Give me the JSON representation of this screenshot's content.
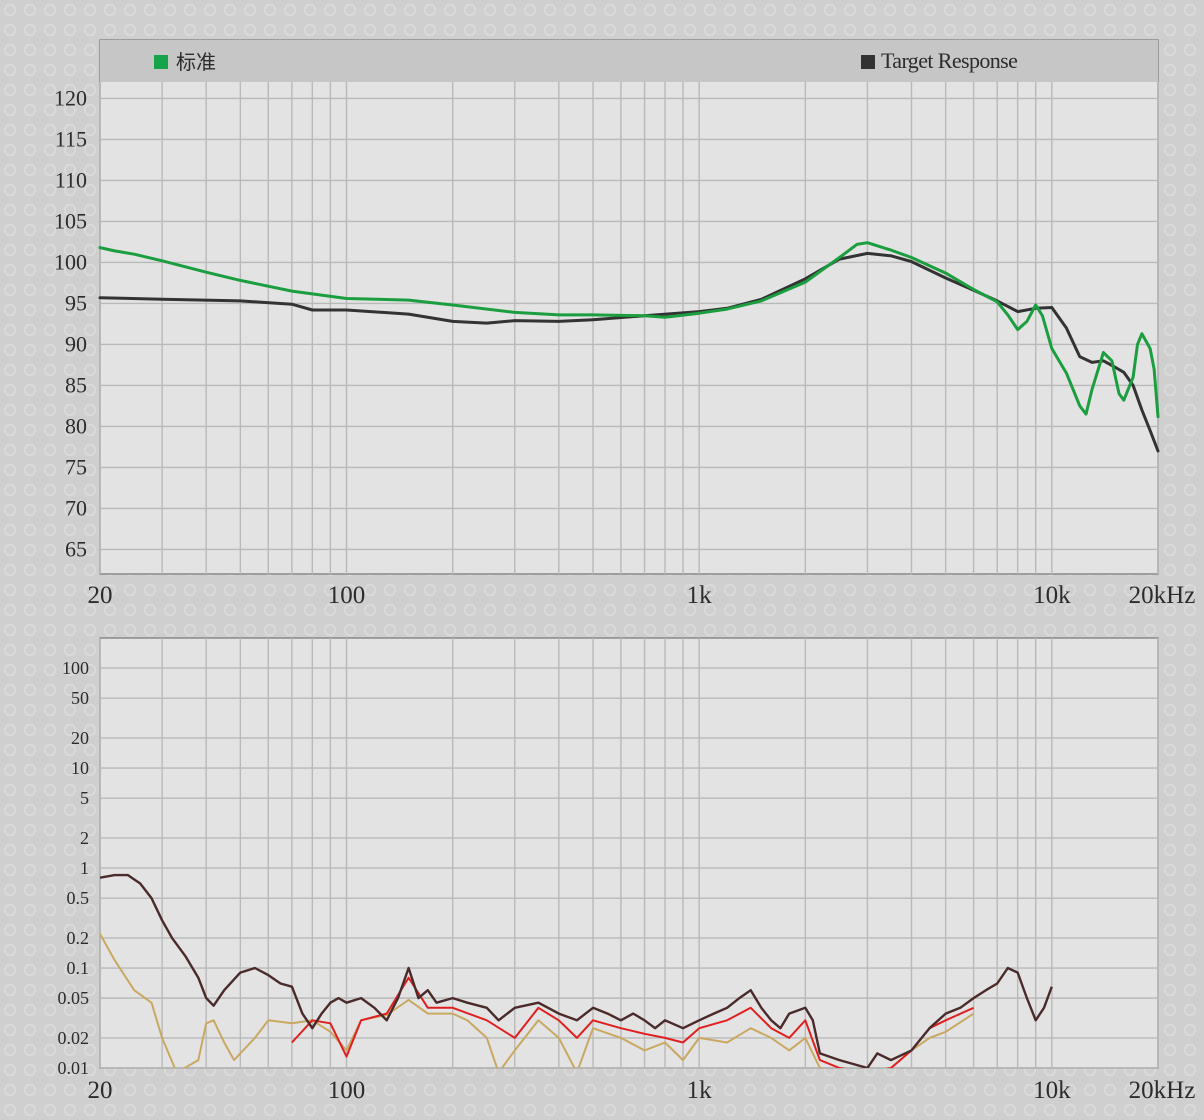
{
  "chart_data": [
    {
      "type": "line",
      "title": "",
      "xlabel": "",
      "ylabel": "",
      "x_scale": "log",
      "xlim": [
        20,
        20000
      ],
      "ylim": [
        62,
        122
      ],
      "x_tick_labels": [
        {
          "x": 20,
          "label": "20"
        },
        {
          "x": 100,
          "label": "100"
        },
        {
          "x": 1000,
          "label": "1k"
        },
        {
          "x": 10000,
          "label": "10k"
        },
        {
          "x": 20000,
          "label": "20kHz"
        }
      ],
      "y_tick_labels": [
        "120",
        "115",
        "110",
        "105",
        "100",
        "95",
        "90",
        "85",
        "80",
        "75",
        "70",
        "65"
      ],
      "y_ticks": [
        120,
        115,
        110,
        105,
        100,
        95,
        90,
        85,
        80,
        75,
        70,
        65
      ],
      "grid": true,
      "legend_position": "top",
      "legend": [
        {
          "label": "标准",
          "color": "#16a34a"
        },
        {
          "label": "Target Response",
          "color": "#333333"
        }
      ],
      "series": [
        {
          "name": "标准",
          "color": "#1a9e3f",
          "points": [
            [
              20,
              101.8
            ],
            [
              22,
              101.4
            ],
            [
              25,
              101
            ],
            [
              30,
              100.2
            ],
            [
              40,
              98.8
            ],
            [
              50,
              97.8
            ],
            [
              70,
              96.5
            ],
            [
              100,
              95.6
            ],
            [
              150,
              95.4
            ],
            [
              200,
              94.8
            ],
            [
              300,
              93.9
            ],
            [
              400,
              93.6
            ],
            [
              500,
              93.6
            ],
            [
              700,
              93.5
            ],
            [
              800,
              93.3
            ],
            [
              1000,
              93.8
            ],
            [
              1200,
              94.3
            ],
            [
              1500,
              95.3
            ],
            [
              2000,
              97.6
            ],
            [
              2500,
              100.6
            ],
            [
              2800,
              102.2
            ],
            [
              3000,
              102.4
            ],
            [
              3500,
              101.5
            ],
            [
              4000,
              100.6
            ],
            [
              5000,
              98.7
            ],
            [
              6000,
              96.7
            ],
            [
              7000,
              95.2
            ],
            [
              7500,
              93.6
            ],
            [
              8000,
              91.8
            ],
            [
              8500,
              92.8
            ],
            [
              9000,
              94.8
            ],
            [
              9400,
              93.5
            ],
            [
              10000,
              89.5
            ],
            [
              11000,
              86.5
            ],
            [
              12000,
              82.5
            ],
            [
              12500,
              81.5
            ],
            [
              13000,
              84.5
            ],
            [
              14000,
              89
            ],
            [
              14800,
              88
            ],
            [
              15500,
              84
            ],
            [
              16000,
              83.2
            ],
            [
              17000,
              86
            ],
            [
              17500,
              90
            ],
            [
              18000,
              91.3
            ],
            [
              19000,
              89.5
            ],
            [
              19500,
              87
            ],
            [
              20000,
              81.2
            ]
          ]
        },
        {
          "name": "Target Response",
          "color": "#333333",
          "points": [
            [
              20,
              95.7
            ],
            [
              30,
              95.5
            ],
            [
              50,
              95.3
            ],
            [
              70,
              94.9
            ],
            [
              80,
              94.2
            ],
            [
              100,
              94.2
            ],
            [
              150,
              93.7
            ],
            [
              200,
              92.8
            ],
            [
              250,
              92.6
            ],
            [
              300,
              92.9
            ],
            [
              400,
              92.8
            ],
            [
              500,
              93
            ],
            [
              700,
              93.5
            ],
            [
              1000,
              94
            ],
            [
              1200,
              94.4
            ],
            [
              1500,
              95.5
            ],
            [
              2000,
              98
            ],
            [
              2500,
              100.4
            ],
            [
              3000,
              101.1
            ],
            [
              3500,
              100.8
            ],
            [
              4000,
              100.1
            ],
            [
              5000,
              98.1
            ],
            [
              6000,
              96.6
            ],
            [
              7000,
              95.3
            ],
            [
              8000,
              94
            ],
            [
              9000,
              94.4
            ],
            [
              10000,
              94.5
            ],
            [
              11000,
              92
            ],
            [
              12000,
              88.5
            ],
            [
              13000,
              87.8
            ],
            [
              14000,
              88
            ],
            [
              15000,
              87.3
            ],
            [
              16000,
              86.6
            ],
            [
              17000,
              85
            ],
            [
              18000,
              82
            ],
            [
              19000,
              79.5
            ],
            [
              20000,
              77
            ]
          ]
        }
      ]
    },
    {
      "type": "line",
      "title": "",
      "xlabel": "",
      "ylabel": "",
      "x_scale": "log",
      "y_scale": "log",
      "xlim": [
        20,
        20000
      ],
      "ylim": [
        0.01,
        200
      ],
      "x_tick_labels": [
        {
          "x": 20,
          "label": "20"
        },
        {
          "x": 100,
          "label": "100"
        },
        {
          "x": 1000,
          "label": "1k"
        },
        {
          "x": 10000,
          "label": "10k"
        },
        {
          "x": 20000,
          "label": "20kHz"
        }
      ],
      "y_tick_labels": [
        "100",
        "50",
        "20",
        "10",
        "5",
        "2",
        "1",
        "0.5",
        "0.2",
        "0.1",
        "0.05",
        "0.02",
        "0.01"
      ],
      "y_ticks": [
        100,
        50,
        20,
        10,
        5,
        2,
        1,
        0.5,
        0.2,
        0.1,
        0.05,
        0.02,
        0.01
      ],
      "grid": true,
      "series": [
        {
          "color": "#c9a862",
          "points": [
            [
              20,
              0.22
            ],
            [
              22,
              0.12
            ],
            [
              25,
              0.06
            ],
            [
              28,
              0.045
            ],
            [
              30,
              0.02
            ],
            [
              33,
              0.009
            ],
            [
              38,
              0.012
            ],
            [
              40,
              0.028
            ],
            [
              42,
              0.03
            ],
            [
              45,
              0.018
            ],
            [
              48,
              0.012
            ],
            [
              55,
              0.02
            ],
            [
              60,
              0.03
            ],
            [
              70,
              0.028
            ],
            [
              80,
              0.03
            ],
            [
              90,
              0.023
            ],
            [
              100,
              0.015
            ],
            [
              110,
              0.03
            ],
            [
              130,
              0.034
            ],
            [
              150,
              0.048
            ],
            [
              170,
              0.035
            ],
            [
              200,
              0.035
            ],
            [
              220,
              0.03
            ],
            [
              250,
              0.02
            ],
            [
              270,
              0.009
            ],
            [
              300,
              0.015
            ],
            [
              350,
              0.03
            ],
            [
              400,
              0.02
            ],
            [
              450,
              0.009
            ],
            [
              500,
              0.025
            ],
            [
              600,
              0.02
            ],
            [
              700,
              0.015
            ],
            [
              800,
              0.018
            ],
            [
              900,
              0.012
            ],
            [
              1000,
              0.02
            ],
            [
              1200,
              0.018
            ],
            [
              1400,
              0.025
            ],
            [
              1600,
              0.02
            ],
            [
              1800,
              0.015
            ],
            [
              2000,
              0.02
            ],
            [
              2200,
              0.01
            ],
            [
              2500,
              0.009
            ],
            [
              3000,
              0.009
            ],
            [
              3500,
              0.01
            ],
            [
              4000,
              0.015
            ],
            [
              4500,
              0.02
            ],
            [
              5000,
              0.023
            ],
            [
              6000,
              0.035
            ]
          ]
        },
        {
          "color": "#e02020",
          "points": [
            [
              70,
              0.018
            ],
            [
              80,
              0.03
            ],
            [
              90,
              0.028
            ],
            [
              100,
              0.013
            ],
            [
              110,
              0.03
            ],
            [
              130,
              0.035
            ],
            [
              150,
              0.08
            ],
            [
              170,
              0.04
            ],
            [
              200,
              0.04
            ],
            [
              250,
              0.03
            ],
            [
              300,
              0.02
            ],
            [
              350,
              0.04
            ],
            [
              400,
              0.03
            ],
            [
              450,
              0.02
            ],
            [
              500,
              0.03
            ],
            [
              600,
              0.025
            ],
            [
              700,
              0.022
            ],
            [
              800,
              0.02
            ],
            [
              900,
              0.018
            ],
            [
              1000,
              0.025
            ],
            [
              1200,
              0.03
            ],
            [
              1400,
              0.04
            ],
            [
              1600,
              0.025
            ],
            [
              1800,
              0.02
            ],
            [
              2000,
              0.03
            ],
            [
              2200,
              0.012
            ],
            [
              2500,
              0.01
            ],
            [
              3000,
              0.009
            ],
            [
              3500,
              0.01
            ],
            [
              4000,
              0.015
            ],
            [
              4500,
              0.025
            ],
            [
              5000,
              0.03
            ],
            [
              6000,
              0.04
            ]
          ]
        },
        {
          "color": "#4a2a2a",
          "points": [
            [
              20,
              0.8
            ],
            [
              22,
              0.85
            ],
            [
              24,
              0.85
            ],
            [
              26,
              0.7
            ],
            [
              28,
              0.5
            ],
            [
              30,
              0.3
            ],
            [
              32,
              0.2
            ],
            [
              35,
              0.13
            ],
            [
              38,
              0.08
            ],
            [
              40,
              0.05
            ],
            [
              42,
              0.042
            ],
            [
              45,
              0.06
            ],
            [
              50,
              0.09
            ],
            [
              55,
              0.1
            ],
            [
              60,
              0.085
            ],
            [
              65,
              0.07
            ],
            [
              70,
              0.065
            ],
            [
              75,
              0.035
            ],
            [
              80,
              0.025
            ],
            [
              85,
              0.035
            ],
            [
              90,
              0.045
            ],
            [
              95,
              0.05
            ],
            [
              100,
              0.045
            ],
            [
              110,
              0.05
            ],
            [
              120,
              0.04
            ],
            [
              130,
              0.03
            ],
            [
              140,
              0.05
            ],
            [
              150,
              0.1
            ],
            [
              160,
              0.05
            ],
            [
              170,
              0.06
            ],
            [
              180,
              0.045
            ],
            [
              200,
              0.05
            ],
            [
              220,
              0.045
            ],
            [
              250,
              0.04
            ],
            [
              270,
              0.03
            ],
            [
              300,
              0.04
            ],
            [
              350,
              0.045
            ],
            [
              400,
              0.035
            ],
            [
              450,
              0.03
            ],
            [
              500,
              0.04
            ],
            [
              550,
              0.035
            ],
            [
              600,
              0.03
            ],
            [
              650,
              0.035
            ],
            [
              700,
              0.03
            ],
            [
              750,
              0.025
            ],
            [
              800,
              0.03
            ],
            [
              900,
              0.025
            ],
            [
              1000,
              0.03
            ],
            [
              1100,
              0.035
            ],
            [
              1200,
              0.04
            ],
            [
              1300,
              0.05
            ],
            [
              1400,
              0.06
            ],
            [
              1500,
              0.04
            ],
            [
              1600,
              0.03
            ],
            [
              1700,
              0.025
            ],
            [
              1800,
              0.035
            ],
            [
              2000,
              0.04
            ],
            [
              2100,
              0.03
            ],
            [
              2200,
              0.014
            ],
            [
              2500,
              0.012
            ],
            [
              3000,
              0.01
            ],
            [
              3200,
              0.014
            ],
            [
              3500,
              0.012
            ],
            [
              4000,
              0.015
            ],
            [
              4500,
              0.025
            ],
            [
              5000,
              0.035
            ],
            [
              5500,
              0.04
            ],
            [
              6000,
              0.05
            ],
            [
              6500,
              0.06
            ],
            [
              7000,
              0.07
            ],
            [
              7500,
              0.1
            ],
            [
              8000,
              0.09
            ],
            [
              8500,
              0.05
            ],
            [
              9000,
              0.03
            ],
            [
              9500,
              0.04
            ],
            [
              10000,
              0.065
            ]
          ]
        }
      ]
    }
  ]
}
